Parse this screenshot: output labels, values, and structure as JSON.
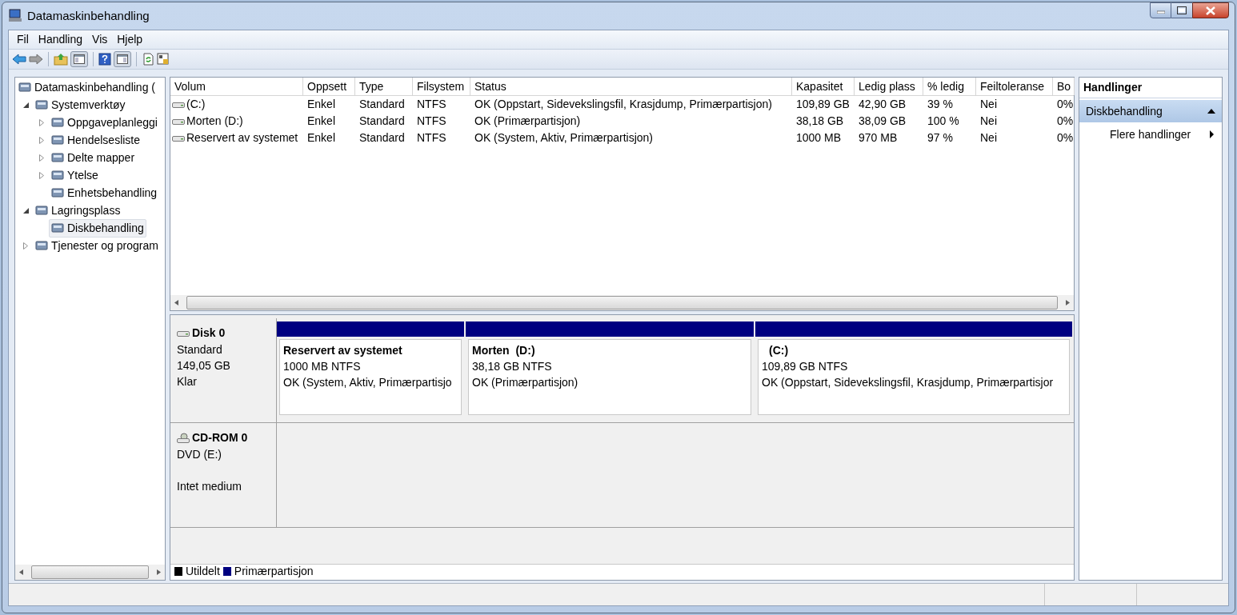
{
  "window": {
    "title": "Datamaskinbehandling"
  },
  "menu": [
    "Fil",
    "Handling",
    "Vis",
    "Hjelp"
  ],
  "tree": [
    {
      "label": "Datamaskinbehandling (",
      "selected": false,
      "children": [
        {
          "label": "Systemverktøy",
          "selected": false,
          "expanded": true,
          "children": [
            {
              "label": "Oppgaveplanleggi",
              "selected": false,
              "expanded": false
            },
            {
              "label": "Hendelsesliste",
              "selected": false,
              "expanded": false
            },
            {
              "label": "Delte mapper",
              "selected": false,
              "expanded": false
            },
            {
              "label": "Ytelse",
              "selected": false,
              "expanded": false
            },
            {
              "label": "Enhetsbehandling",
              "selected": false
            }
          ]
        },
        {
          "label": "Lagringsplass",
          "selected": false,
          "expanded": true,
          "children": [
            {
              "label": "Diskbehandling",
              "selected": true
            }
          ]
        },
        {
          "label": "Tjenester og program",
          "selected": false,
          "expanded": false
        }
      ]
    }
  ],
  "table": {
    "columns": [
      "Volum",
      "Oppsett",
      "Type",
      "Filsystem",
      "Status",
      "Kapasitet",
      "Ledig plass",
      "% ledig",
      "Feiltoleranse",
      "Bo"
    ],
    "rows": [
      [
        "(C:)",
        "Enkel",
        "Standard",
        "NTFS",
        "OK (Oppstart, Sidevekslingsfil, Krasjdump, Primærpartisjon)",
        "109,89 GB",
        "42,90 GB",
        "39 %",
        "Nei",
        "0%"
      ],
      [
        "Morten (D:)",
        "Enkel",
        "Standard",
        "NTFS",
        "OK (Primærpartisjon)",
        "38,18 GB",
        "38,09 GB",
        "100 %",
        "Nei",
        "0%"
      ],
      [
        "Reservert av systemet",
        "Enkel",
        "Standard",
        "NTFS",
        "OK (System, Aktiv, Primærpartisjon)",
        "1000 MB",
        "970 MB",
        "97 %",
        "Nei",
        "0%"
      ]
    ]
  },
  "disks": [
    {
      "kind": "disk",
      "name": "Disk 0",
      "lines": [
        "Standard",
        "149,05 GB",
        "Klar"
      ],
      "partitions": [
        {
          "label": "Reservert av systemet",
          "size": "1000 MB NTFS",
          "status": "OK (System, Aktiv, Primærpartisjo",
          "color": "#000080"
        },
        {
          "label": "Morten  (D:)",
          "size": "38,18 GB NTFS",
          "status": "OK (Primærpartisjon)",
          "color": "#000080"
        },
        {
          "label": "(C:)",
          "size": "109,89 GB NTFS",
          "status": "OK (Oppstart, Sidevekslingsfil, Krasjdump, Primærpartisjor",
          "color": "#000080"
        }
      ]
    },
    {
      "kind": "cdrom",
      "name": "CD-ROM 0",
      "lines": [
        "DVD (E:)",
        "Intet medium"
      ]
    }
  ],
  "legend": [
    {
      "label": "Utildelt",
      "color": "#000000"
    },
    {
      "label": "Primærpartisjon",
      "color": "#000080"
    }
  ],
  "actions": {
    "title": "Handlinger",
    "section": {
      "label": "Diskbehandling",
      "expanded": true
    },
    "items": [
      "Flere handlinger"
    ]
  }
}
